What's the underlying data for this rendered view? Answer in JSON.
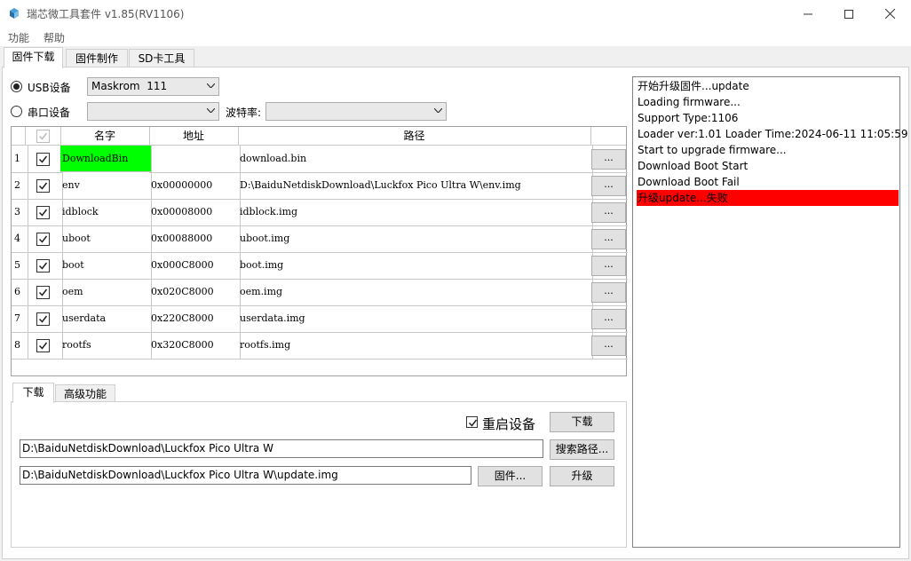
{
  "window": {
    "title": "瑞芯微工具套件 v1.85(RV1106)",
    "minimize_label": "—",
    "maximize_label": "☐",
    "close_label": "✕"
  },
  "menu": [
    "功能",
    "帮助"
  ],
  "tabs": [
    "固件下载",
    "固件制作",
    "SD卡工具"
  ],
  "device": {
    "usb_label": "USB设备",
    "usb_value": "Maskrom  111",
    "serial_label": "串口设备",
    "serial_value": "",
    "baud_label": "波特率:",
    "baud_value": ""
  },
  "grid": {
    "headers": [
      "名字",
      "地址",
      "路径"
    ],
    "dots_label": "...",
    "rows": [
      {
        "num": "1",
        "name": "DownloadBin",
        "addr": "",
        "path": "download.bin",
        "checked": true
      },
      {
        "num": "2",
        "name": "env",
        "addr": "0x00000000",
        "path": "D:\\BaiduNetdiskDownload\\Luckfox Pico Ultra W\\env.img",
        "checked": true
      },
      {
        "num": "3",
        "name": "idblock",
        "addr": "0x00008000",
        "path": "idblock.img",
        "checked": true
      },
      {
        "num": "4",
        "name": "uboot",
        "addr": "0x00088000",
        "path": "uboot.img",
        "checked": true
      },
      {
        "num": "5",
        "name": "boot",
        "addr": "0x000C8000",
        "path": "boot.img",
        "checked": true
      },
      {
        "num": "6",
        "name": "oem",
        "addr": "0x020C8000",
        "path": "oem.img",
        "checked": true
      },
      {
        "num": "7",
        "name": "userdata",
        "addr": "0x220C8000",
        "path": "userdata.img",
        "checked": true
      },
      {
        "num": "8",
        "name": "rootfs",
        "addr": "0x320C8000",
        "path": "rootfs.img",
        "checked": true
      }
    ]
  },
  "subtabs": [
    "下载",
    "高级功能"
  ],
  "download": {
    "reboot_label": "重启设备",
    "reboot_checked": true,
    "download_button": "下载",
    "search_path": "D:\\BaiduNetdiskDownload\\Luckfox Pico Ultra W",
    "search_button": "搜索路径...",
    "firmware_path": "D:\\BaiduNetdiskDownload\\Luckfox Pico Ultra W\\update.img",
    "firmware_button": "固件...",
    "upgrade_button": "升级"
  },
  "log": [
    {
      "text": "开始升级固件...update",
      "error": false
    },
    {
      "text": "Loading firmware...",
      "error": false
    },
    {
      "text": "Support Type:1106",
      "error": false
    },
    {
      "text": "Loader ver:1.01 Loader Time:2024-06-11 11:05:59",
      "error": false
    },
    {
      "text": "Start to upgrade firmware...",
      "error": false
    },
    {
      "text": "Download Boot Start",
      "error": false
    },
    {
      "text": "Download Boot Fail",
      "error": false
    },
    {
      "text": "升级update...失败",
      "error": true
    }
  ],
  "colors": {
    "highlight_green": "#00ff00",
    "error_red": "#ff0000"
  }
}
